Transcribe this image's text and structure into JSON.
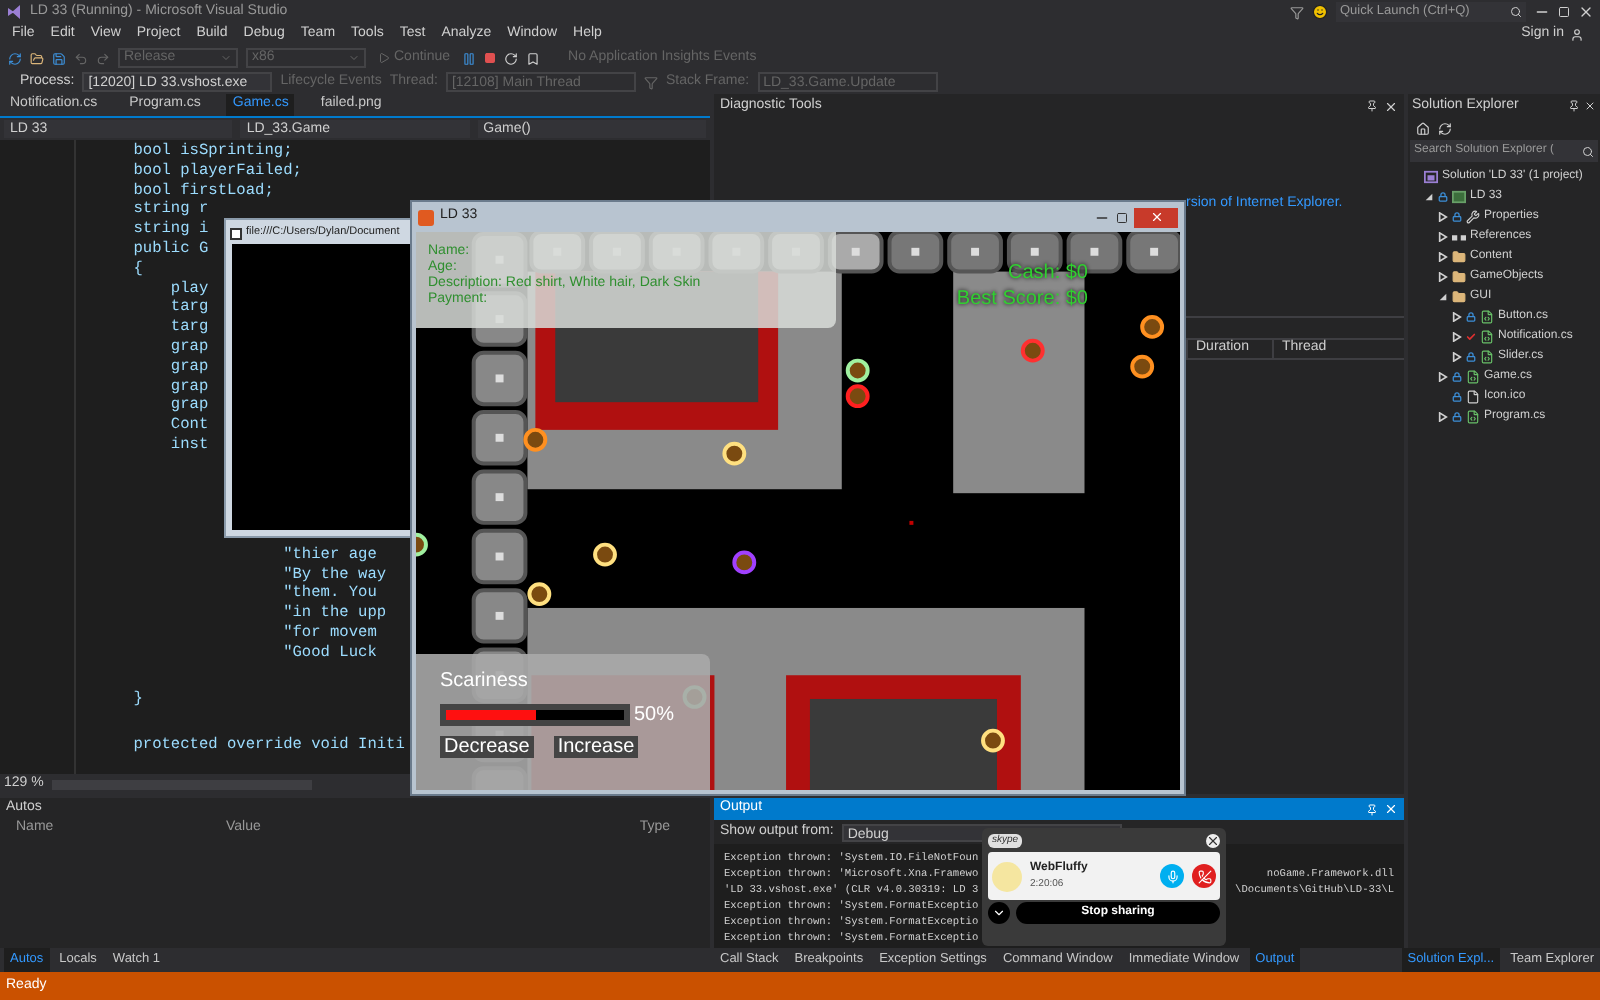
{
  "window": {
    "title": "LD 33 (Running) - Microsoft Visual Studio",
    "quick_launch": {
      "placeholder": "Quick Launch (Ctrl+Q)"
    },
    "account": "Sign in"
  },
  "menu": [
    "File",
    "Edit",
    "View",
    "Project",
    "Build",
    "Debug",
    "Team",
    "Tools",
    "Test",
    "Analyze",
    "Window",
    "Help"
  ],
  "toolbar": [
    {
      "kind": "dropdown",
      "label": "Release",
      "disabled": true
    },
    {
      "kind": "dropdown",
      "label": "x86",
      "disabled": true
    },
    {
      "kind": "button",
      "label": "Continue",
      "disabled": true
    }
  ],
  "insights": "No Application Insights Events",
  "debug_location": {
    "process_label": "Process:",
    "process": "[12020] LD 33.vshost.exe",
    "lifecycle": "Lifecycle Events",
    "thread_label": "Thread:",
    "thread": "[12108] Main Thread",
    "stack_label": "Stack Frame:",
    "stack_frame": "LD_33.Game.Update"
  },
  "editor": {
    "tabs": [
      {
        "label": "Notification.cs",
        "selected": false
      },
      {
        "label": "Program.cs",
        "selected": false
      },
      {
        "label": "Game.cs",
        "selected": true
      },
      {
        "label": "failed.png",
        "selected": false
      }
    ],
    "nav": [
      "LD 33",
      "LD_33.Game",
      "Game()"
    ],
    "code_blocks": [
      [
        "    bool isSprinting;",
        "    bool playerFailed;",
        "    bool firstLoad;",
        "    string r",
        "    string i",
        "    public G",
        "    {",
        "        play",
        "        targ",
        "        targ",
        "        grap",
        "        grap",
        "        grap",
        "        grap",
        "        Cont",
        "        inst"
      ],
      [
        "                    \"thier age",
        "                    \"By the way",
        "                    \"them. You",
        "                    \"in the upp",
        "                    \"for movem",
        "                    \"Good Luck"
      ],
      [
        "    }"
      ],
      [
        "    protected override void Initi"
      ]
    ],
    "zoom": "129 %"
  },
  "diagnostics": {
    "title": "Diagnostic Tools",
    "message": "rsion of Internet Explorer.",
    "columns": [
      "Duration",
      "Thread"
    ]
  },
  "solution_explorer": {
    "title": "Solution Explorer",
    "search": {
      "placeholder": "Search Solution Explorer ("
    },
    "tree": [
      {
        "label": "Solution 'LD 33' (1 project)",
        "kind": "solution",
        "children": [
          {
            "label": "LD 33",
            "kind": "project",
            "expanded": true,
            "checked_out": false,
            "children": [
              {
                "label": "Properties",
                "kind": "properties",
                "expanded": false,
                "checked_out": false
              },
              {
                "label": "References",
                "kind": "references",
                "expanded": false
              },
              {
                "label": "Content",
                "kind": "folder",
                "expanded": false
              },
              {
                "label": "GameObjects",
                "kind": "folder",
                "expanded": false
              },
              {
                "label": "GUI",
                "kind": "folder",
                "expanded": true,
                "children": [
                  {
                    "label": "Button.cs",
                    "kind": "code",
                    "expanded": false,
                    "checked_out": false
                  },
                  {
                    "label": "Notification.cs",
                    "kind": "code",
                    "expanded": false,
                    "checked_out": true
                  },
                  {
                    "label": "Slider.cs",
                    "kind": "code",
                    "expanded": false,
                    "checked_out": false
                  }
                ]
              },
              {
                "label": "Game.cs",
                "kind": "code",
                "expanded": false,
                "checked_out": false
              },
              {
                "label": "Icon.ico",
                "kind": "file",
                "checked_out": false
              },
              {
                "label": "Program.cs",
                "kind": "code",
                "expanded": false,
                "checked_out": false
              }
            ]
          }
        ]
      }
    ]
  },
  "console_window": {
    "title": "file:///C:/Users/Dylan/Document"
  },
  "game_window": {
    "title": "LD 33",
    "info": [
      "Name:",
      "Age:",
      "Description: Red shirt, White hair, Dark Skin",
      "Payment:"
    ],
    "cash": "Cash: $0",
    "best_score": "Best Score: $0",
    "scariness": {
      "label": "Scariness",
      "level": 0.5,
      "reading": "50%",
      "buttons": [
        "Decrease",
        "Increase"
      ]
    }
  },
  "autos": {
    "title": "Autos",
    "columns": [
      "Name",
      "Value",
      "Type"
    ],
    "tabs": [
      {
        "label": "Autos",
        "selected": true
      },
      {
        "label": "Locals",
        "selected": false
      },
      {
        "label": "Watch 1",
        "selected": false
      }
    ]
  },
  "output": {
    "title": "Output",
    "source_label": "Show output from:",
    "source": "Debug",
    "lines": [
      {
        "text": "Exception thrown: 'System.IO.FileNotFoun"
      },
      {
        "text": "Exception thrown: 'Microsoft.Xna.Framewo",
        "tail": "noGame.Framework.dll"
      },
      {
        "text": "'LD 33.vshost.exe' (CLR v4.0.30319: LD 3",
        "tail": "\\Documents\\GitHub\\LD-33\\L"
      },
      {
        "text": "Exception thrown: 'System.FormatExceptio"
      },
      {
        "text": "Exception thrown: 'System.FormatExceptio"
      },
      {
        "text": "Exception thrown: 'System.FormatExceptio"
      }
    ],
    "tabs": [
      {
        "label": "Call Stack",
        "selected": false
      },
      {
        "label": "Breakpoints",
        "selected": false
      },
      {
        "label": "Exception Settings",
        "selected": false
      },
      {
        "label": "Command Window",
        "selected": false
      },
      {
        "label": "Immediate Window",
        "selected": false
      },
      {
        "label": "Output",
        "selected": true
      }
    ]
  },
  "sidebar_tabs": [
    {
      "label": "Solution Expl...",
      "selected": true
    },
    {
      "label": "Team Explorer",
      "selected": false
    }
  ],
  "call_popup": {
    "brand": "skype",
    "name": "WebFluffy",
    "duration": "2:20:06",
    "action": "Stop sharing"
  },
  "status_bar": {
    "text": "Ready"
  }
}
